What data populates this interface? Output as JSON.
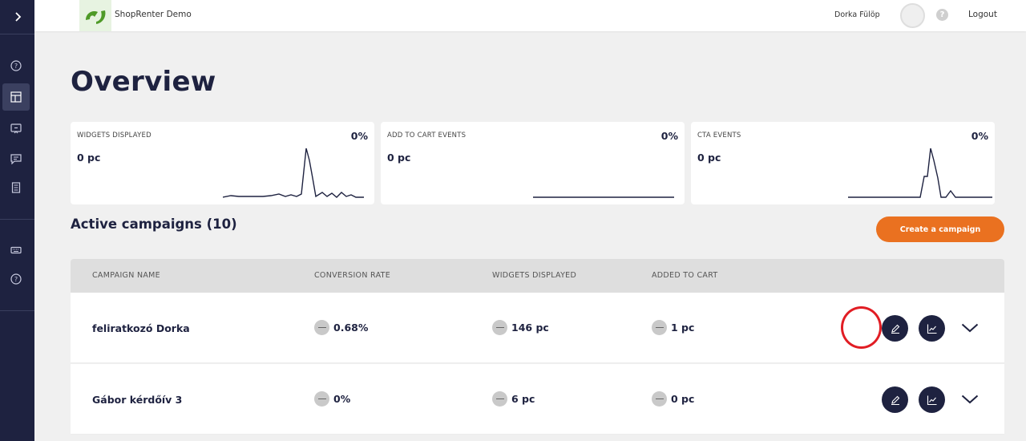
{
  "topbar": {
    "brand": "ShopRenter Demo",
    "user_name": "Dorka Fülöp",
    "help": "?",
    "logout": "Logout"
  },
  "sidebar": {
    "icons": [
      "chevron-right-icon",
      "help-circle-icon",
      "dashboard-icon",
      "widget-icon",
      "message-icon",
      "document-icon",
      "keyboard-icon",
      "help-circle-icon"
    ],
    "active": "dashboard-icon"
  },
  "page": {
    "title": "Overview"
  },
  "stats": [
    {
      "title": "WIDGETS DISPLAYED",
      "percent": "0%",
      "value": "0 pc"
    },
    {
      "title": "ADD TO CART EVENTS",
      "percent": "0%",
      "value": "0 pc"
    },
    {
      "title": "CTA EVENTS",
      "percent": "0%",
      "value": "0 pc"
    }
  ],
  "campaigns": {
    "title": "Active campaigns (10)",
    "create_label": "Create a campaign",
    "columns": [
      "CAMPAIGN NAME",
      "CONVERSION RATE",
      "WIDGETS DISPLAYED",
      "ADDED TO CART"
    ],
    "rows": [
      {
        "name": "feliratkozó Dorka",
        "conversion": "0.68%",
        "widgets": "146 pc",
        "cart": "1 pc"
      },
      {
        "name": "Gábor kérdőív 3",
        "conversion": "0%",
        "widgets": "6 pc",
        "cart": "0 pc"
      }
    ]
  },
  "colors": {
    "navy": "#1e2240",
    "accent": "#ea7120",
    "highlight": "#e11d24"
  }
}
